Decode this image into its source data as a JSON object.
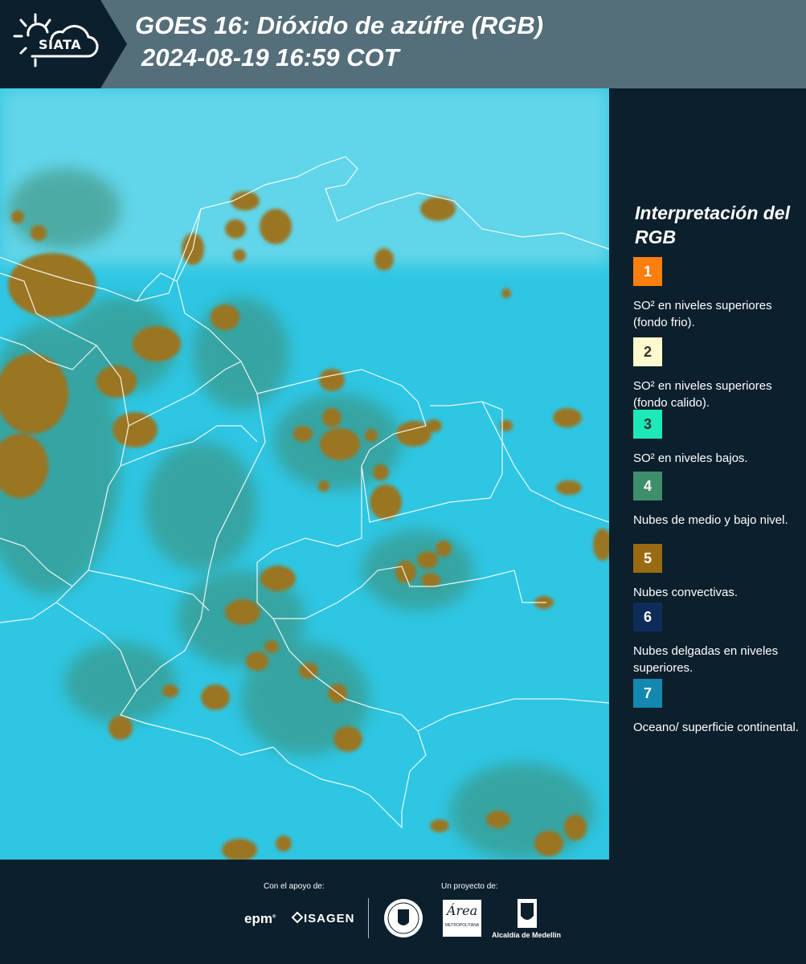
{
  "header": {
    "logo_name": "SIATA",
    "title_line1": "GOES 16: Dióxido de azúfre (RGB)",
    "title_line2": "2024-08-19 16:59 COT"
  },
  "legend": {
    "title": "Interpretación del RGB",
    "items": [
      {
        "num": "1",
        "color": "#ff7f0e",
        "text": "SO² en niveles superiores (fondo frio)."
      },
      {
        "num": "2",
        "color": "#fffacd",
        "text": "SO² en niveles superiores (fondo calido)."
      },
      {
        "num": "3",
        "color": "#1de9b6",
        "text": "SO² en niveles bajos."
      },
      {
        "num": "4",
        "color": "#3e8e6b",
        "text": "Nubes de medio y bajo nivel."
      },
      {
        "num": "5",
        "color": "#9a6a12",
        "text": "Nubes convectivas."
      },
      {
        "num": "6",
        "color": "#0d2c5a",
        "text": "Nubes delgadas en niveles superiores."
      },
      {
        "num": "7",
        "color": "#1388b0",
        "text": "Oceano/ superficie continental."
      }
    ]
  },
  "footer": {
    "support_label": "Con el apoyo de:",
    "project_label": "Un proyecto de:",
    "partner_epm": "epm",
    "partner_isagen": "ISAGEN",
    "partner_area": "Área",
    "partner_area_sub": "METROPOLITANA",
    "partner_alcaldia": "Alcaldía de Medellín"
  }
}
